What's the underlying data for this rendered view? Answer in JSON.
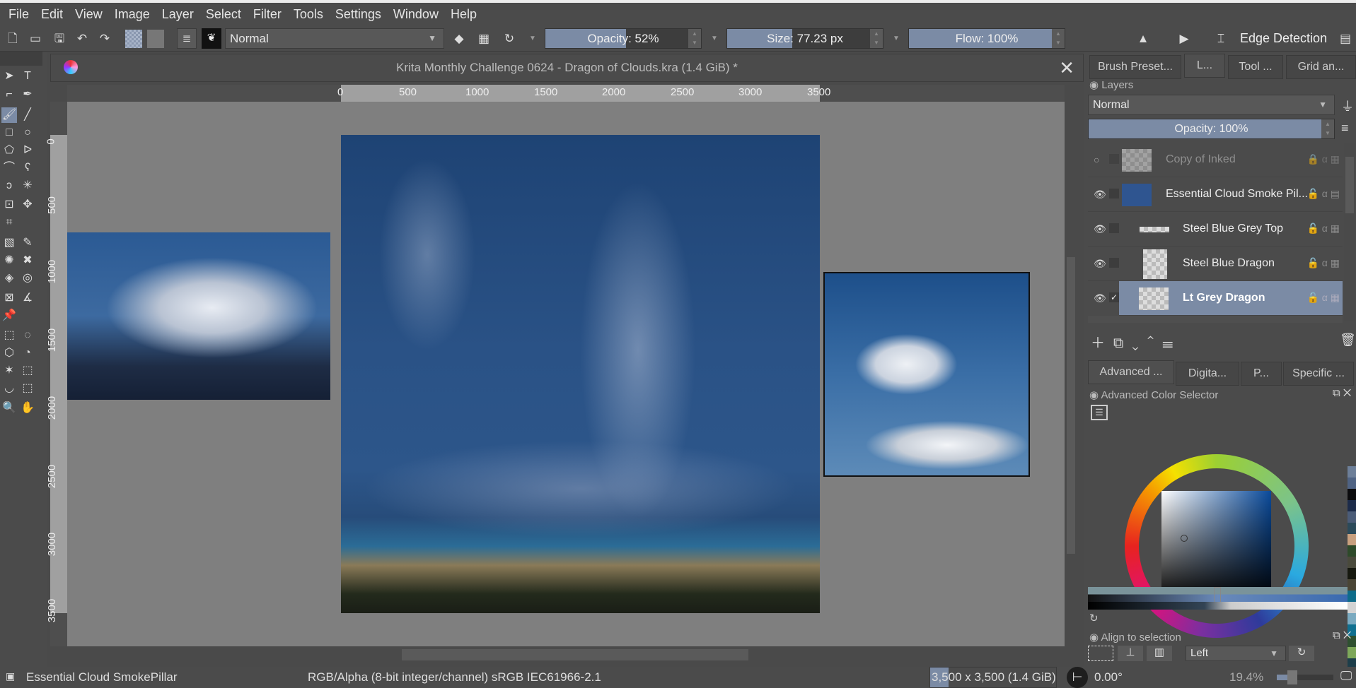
{
  "menu": [
    "File",
    "Edit",
    "View",
    "Image",
    "Layer",
    "Select",
    "Filter",
    "Tools",
    "Settings",
    "Window",
    "Help"
  ],
  "toolbar": {
    "blend_mode": "Normal",
    "opacity_label": "Opacity: 52%",
    "opacity_value": 52,
    "size_label": "Size: 77.23 px",
    "flow_label": "Flow: 100%",
    "flow_value": 100,
    "edge_detection": "Edge Detection"
  },
  "document": {
    "title": "Krita Monthly Challenge 0624 - Dragon of Clouds.kra (1.4 GiB) *"
  },
  "ruler": {
    "h": [
      "0",
      "500",
      "1000",
      "1500",
      "2000",
      "2500",
      "3000",
      "3500"
    ],
    "v": [
      "0",
      "500",
      "1000",
      "1500",
      "2000",
      "2500",
      "3000",
      "3500"
    ]
  },
  "panel_tabs": [
    "Brush Preset...",
    "L...",
    "Tool ...",
    "Grid an..."
  ],
  "layers": {
    "title": "Layers",
    "blend_mode": "Normal",
    "opacity_label": "Opacity:  100%",
    "items": [
      {
        "name": "Copy of Inked",
        "visible": false,
        "selected": false
      },
      {
        "name": "Essential Cloud Smoke Pil...",
        "visible": true,
        "selected": false
      },
      {
        "name": "Steel Blue Grey Top",
        "visible": true,
        "selected": false
      },
      {
        "name": "Steel Blue Dragon",
        "visible": true,
        "selected": false
      },
      {
        "name": "Lt Grey Dragon",
        "visible": true,
        "selected": true
      }
    ]
  },
  "color_tabs": [
    "Advanced ...",
    "Digita...",
    "P...",
    "Specific ..."
  ],
  "color_selector": {
    "title": "Advanced Color Selector",
    "swatches": [
      "#6d7f99",
      "#4f6384",
      "#0b0b0d",
      "#1c2b4a",
      "#4b5c78",
      "#2b4a5a",
      "#c8a07f",
      "#2e4a2a",
      "#4a4a3c",
      "#16180f",
      "#4a4535",
      "#0e6c8a",
      "#d3d3d3",
      "#7aaac0",
      "#107090",
      "#2e5030",
      "#7ea85a",
      "#1d3e4a",
      "#8a5a2a"
    ]
  },
  "align": {
    "title": "Align to selection",
    "mode": "Left"
  },
  "status": {
    "layer": "Essential Cloud SmokePillar",
    "color_space": "RGB/Alpha (8-bit integer/channel)  sRGB IEC61966-2.1",
    "dimensions": "3,500 x 3,500 (1.4 GiB)",
    "rotation": "0.00°",
    "zoom": "19.4%"
  }
}
